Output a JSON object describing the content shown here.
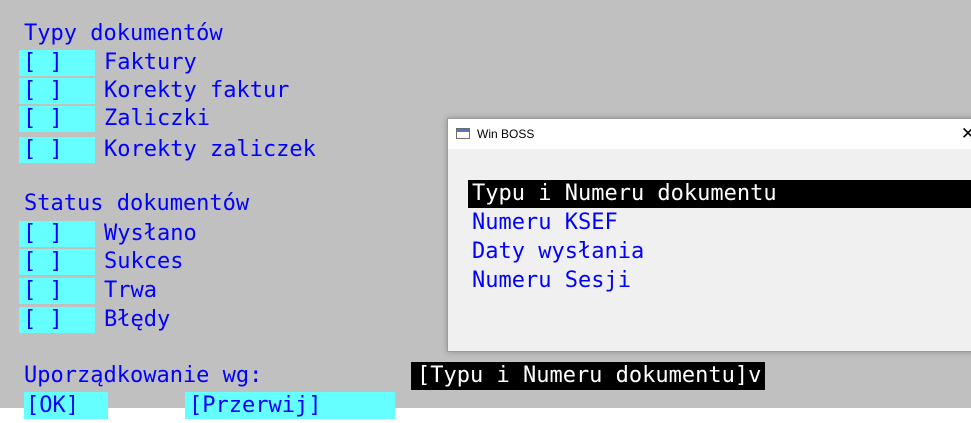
{
  "document_types": {
    "heading": "Typy dokumentów",
    "items": [
      {
        "checkbox": "[ ]",
        "label": "Faktury"
      },
      {
        "checkbox": "[ ]",
        "label": "Korekty faktur"
      },
      {
        "checkbox": "[ ]",
        "label": "Zaliczki"
      },
      {
        "checkbox": "[ ]",
        "label": "Korekty zaliczek"
      }
    ]
  },
  "document_status": {
    "heading": "Status dokumentów",
    "items": [
      {
        "checkbox": "[ ]",
        "label": "Wysłano"
      },
      {
        "checkbox": "[ ]",
        "label": "Sukces"
      },
      {
        "checkbox": "[ ]",
        "label": "Trwa"
      },
      {
        "checkbox": "[ ]",
        "label": "Błędy"
      }
    ]
  },
  "ordering": {
    "label": "Uporządkowanie wg:",
    "value": "[Typu i Numeru dokumentu]v"
  },
  "buttons": {
    "ok": "[OK]",
    "cancel": "[Przerwij]"
  },
  "popup": {
    "title": "Win BOSS",
    "close_glyph": "✕",
    "options": [
      "Typu i Numeru dokumentu",
      "Numeru KSEF",
      "Daty wysłania",
      "Numeru Sesji"
    ],
    "selected_index": 0
  },
  "colors": {
    "background": "#c0c0c0",
    "text": "#0000ff",
    "field_highlight": "#66ffff",
    "selection_bg": "#000000",
    "selection_text": "#ffffff"
  }
}
